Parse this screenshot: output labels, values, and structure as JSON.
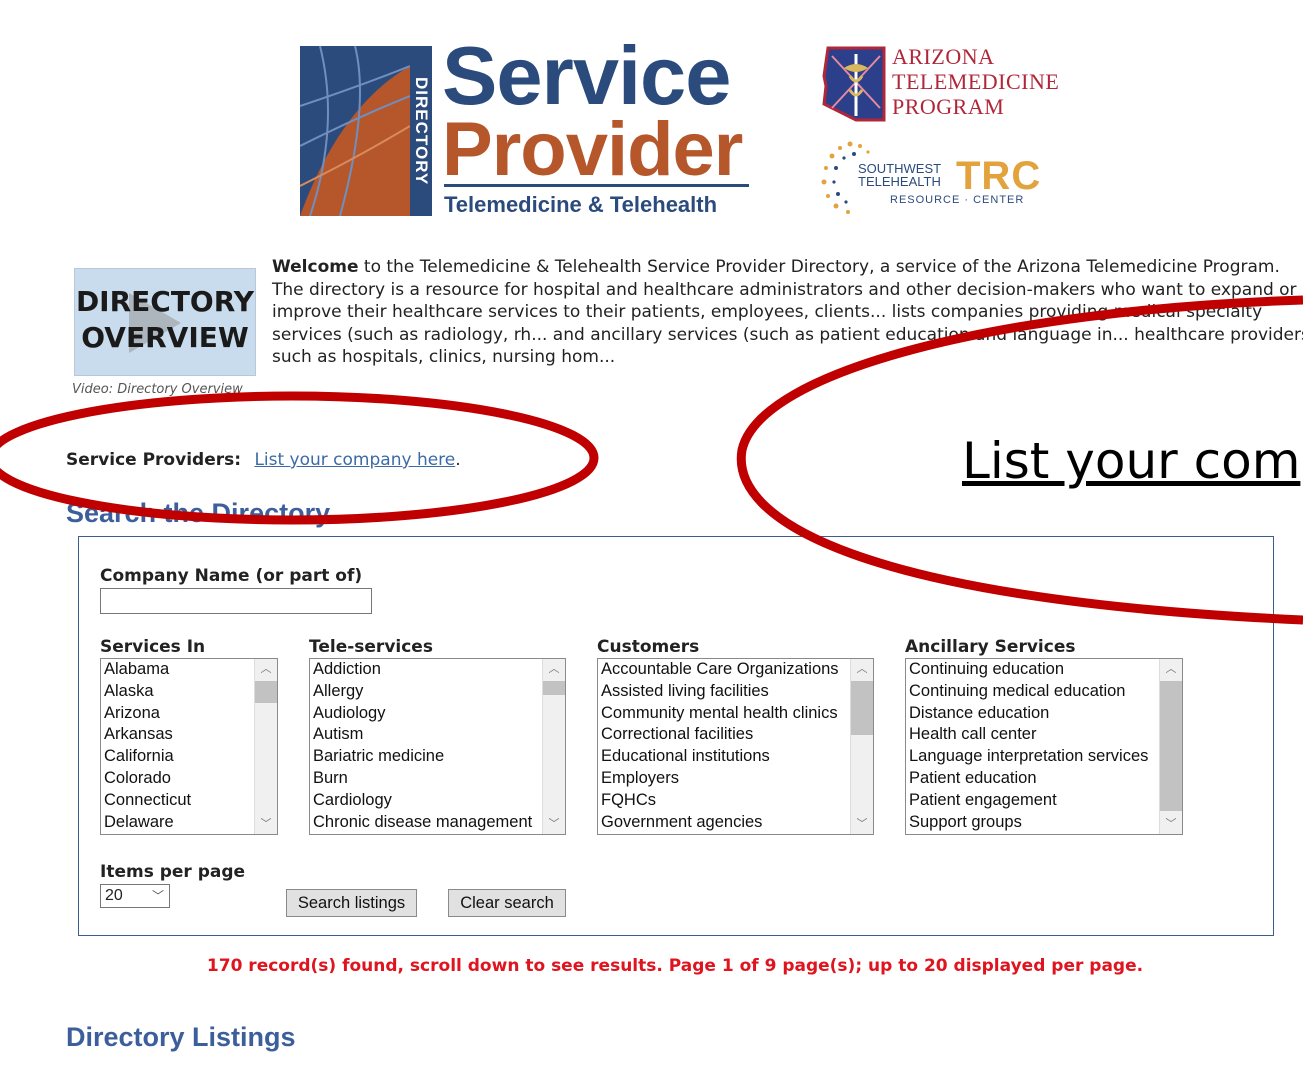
{
  "header": {
    "logo_main": {
      "directory": "DIRECTORY",
      "service": "Service",
      "provider": "Provider",
      "tagline": "Telemedicine & Telehealth"
    },
    "logo_az": [
      "ARIZONA",
      "TELEMEDICINE",
      "PROGRAM"
    ],
    "logo_trc": {
      "line1": "SOUTHWEST",
      "line2": "TELEHEALTH",
      "big": "TRC",
      "sub": "RESOURCE · CENTER"
    }
  },
  "video": {
    "thumb_line1": "DIRECTORY",
    "thumb_line2": "OVERVIEW",
    "caption": "Video: Directory Overview"
  },
  "welcome": {
    "bold": "Welcome",
    "text": " to the Telemedicine & Telehealth Service Provider Directory, a service of the Arizona Telemedicine Program. The directory is a resource for hospital and healthcare administrators and other decision-makers who want to expand or improve their healthcare services to their patients, employees, clients... lists companies providing medical specialty services (such as radiology, rh... and ancillary services (such as patient education and language in... healthcare providers such as hospitals, clinics, nursing hom..."
  },
  "service_providers": {
    "label": "Service Providers:",
    "link": "List your company here",
    "period": "."
  },
  "zoom_callout": "List your com",
  "search": {
    "heading": "Search the Directory",
    "company_label": "Company Name (or part of)",
    "company_value": "",
    "services_in": {
      "label": "Services In",
      "options": [
        "Alabama",
        "Alaska",
        "Arizona",
        "Arkansas",
        "California",
        "Colorado",
        "Connecticut",
        "Delaware"
      ]
    },
    "tele_services": {
      "label": "Tele-services",
      "options": [
        "Addiction",
        "Allergy",
        "Audiology",
        "Autism",
        "Bariatric medicine",
        "Burn",
        "Cardiology",
        "Chronic disease management"
      ]
    },
    "customers": {
      "label": "Customers",
      "options": [
        "Accountable Care Organizations",
        "Assisted living facilities",
        "Community mental health clinics",
        "Correctional facilities",
        "Educational institutions",
        "Employers",
        "FQHCs",
        "Government agencies"
      ]
    },
    "ancillary": {
      "label": "Ancillary Services",
      "options": [
        "Continuing education",
        "Continuing medical education",
        "Distance education",
        "Health call center",
        "Language interpretation services",
        "Patient education",
        "Patient engagement",
        "Support groups"
      ]
    },
    "items_per_page_label": "Items per page",
    "items_per_page_value": "20",
    "search_button": "Search listings",
    "clear_button": "Clear search"
  },
  "results": {
    "records_text": "170 record(s) found, scroll down to see results. Page 1 of 9 page(s); up to 20 displayed per page.",
    "total_records": 170,
    "current_page": 1,
    "total_pages": 9,
    "per_page": 20
  },
  "listings_heading": "Directory Listings",
  "colors": {
    "heading_blue": "#3c5f9b",
    "link_blue": "#3b6aa6",
    "records_red": "#e0141e",
    "annotation_red": "#c00000",
    "logo_orange": "#b5572a",
    "az_red": "#b0273a",
    "trc_gold": "#e3a33c"
  }
}
